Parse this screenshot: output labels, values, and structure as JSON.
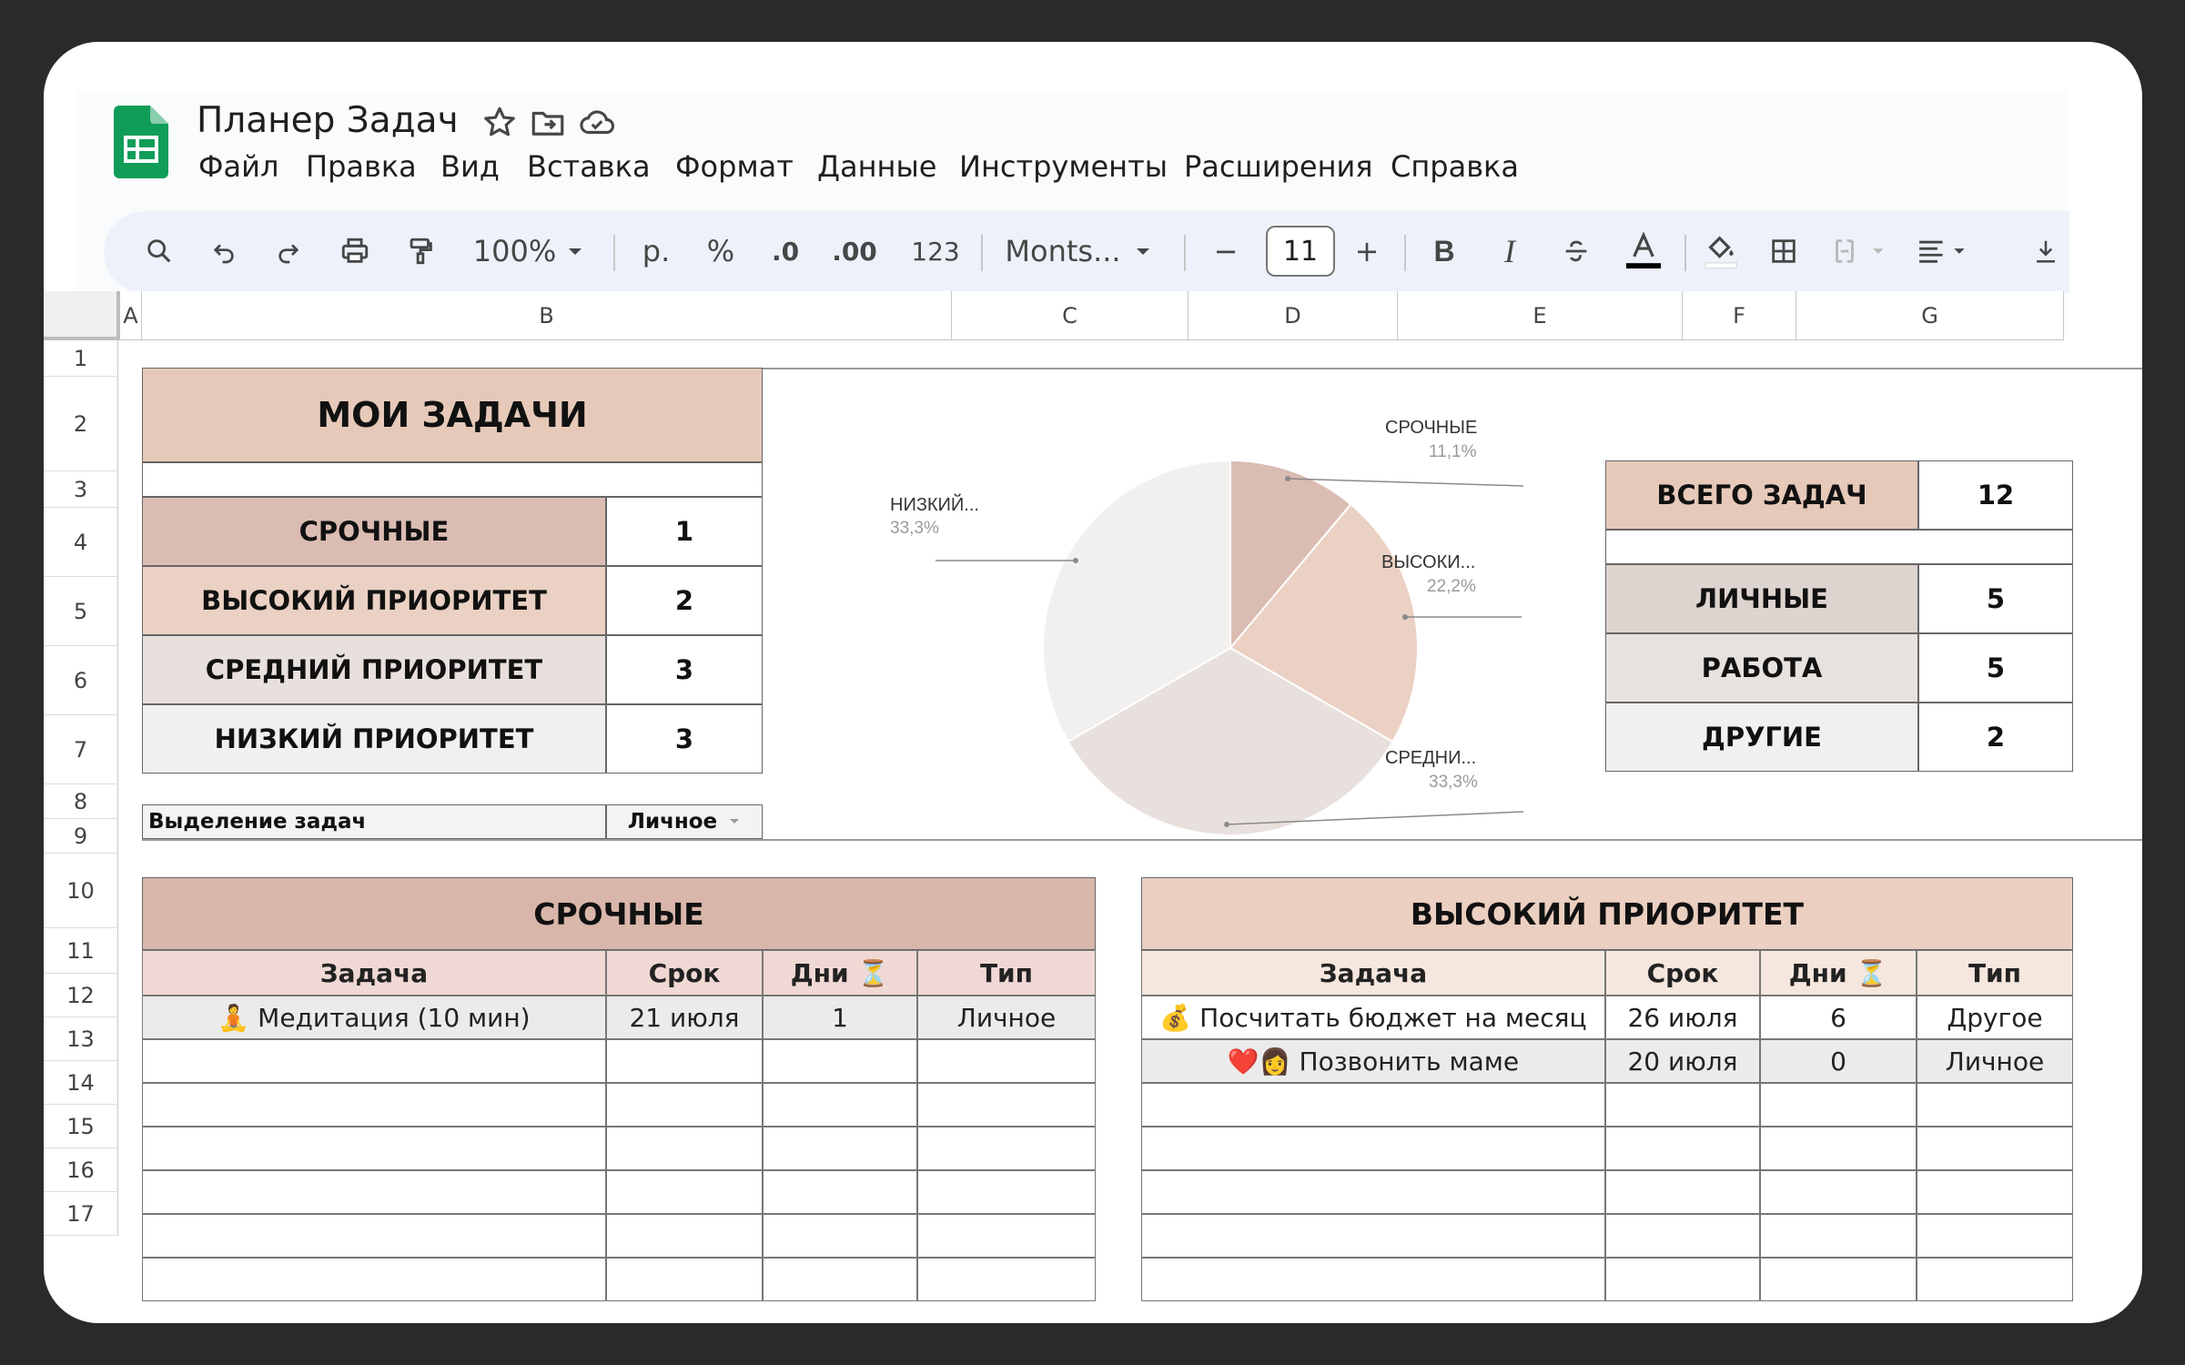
{
  "app": {
    "title": "Планер Задач",
    "menu": [
      "Файл",
      "Правка",
      "Вид",
      "Вставка",
      "Формат",
      "Данные",
      "Инструменты",
      "Расширения",
      "Справка"
    ]
  },
  "toolbar": {
    "zoom": "100%",
    "currency": "р.",
    "percent": "%",
    "dec_less": ".0",
    "dec_more": ".00",
    "number_format": "123",
    "font": "Monts...",
    "font_size": "11",
    "minus": "−",
    "plus": "+",
    "bold": "B",
    "italic": "I"
  },
  "columns": [
    "A",
    "B",
    "C",
    "D",
    "E",
    "F",
    "G"
  ],
  "rows": [
    "1",
    "2",
    "3",
    "4",
    "5",
    "6",
    "7",
    "8",
    "9",
    "10",
    "11",
    "12",
    "13",
    "14",
    "15",
    "16",
    "17"
  ],
  "summary": {
    "title": "МОИ ЗАДАЧИ",
    "items": [
      {
        "label": "СРОЧНЫЕ",
        "value": "1",
        "color": "#dbbcb2"
      },
      {
        "label": "ВЫСОКИЙ ПРИОРИТЕТ",
        "value": "2",
        "color": "#ebd1c3"
      },
      {
        "label": "СРЕДНИЙ ПРИОРИТЕТ",
        "value": "3",
        "color": "#e8e0dc"
      },
      {
        "label": "НИЗКИЙ ПРИОРИТЕТ",
        "value": "3",
        "color": "#f2f0ee"
      }
    ],
    "filter_label": "Выделение задач",
    "filter_value": "Личное"
  },
  "chart_data": {
    "type": "pie",
    "slices": [
      {
        "label": "СРОЧНЫЕ",
        "value": 11.1,
        "pct": "11,1%",
        "color": "#dbbcb2"
      },
      {
        "label": "ВЫСОКИ...",
        "value": 22.2,
        "pct": "22,2%",
        "color": "#ebd1c3"
      },
      {
        "label": "СРЕДНИ...",
        "value": 33.3,
        "pct": "33,3%",
        "color": "#e8e0dc"
      },
      {
        "label": "НИЗКИЙ...",
        "value": 33.3,
        "pct": "33,3%",
        "color": "#f2f0ee"
      }
    ]
  },
  "totals": {
    "total_label": "ВСЕГО ЗАДАЧ",
    "total_value": "12",
    "items": [
      {
        "label": "ЛИЧНЫЕ",
        "value": "5",
        "color": "#ddd3cf"
      },
      {
        "label": "РАБОТА",
        "value": "5",
        "color": "#e8e2df"
      },
      {
        "label": "ДРУГИЕ",
        "value": "2",
        "color": "#f2f0ee"
      }
    ]
  },
  "urgent": {
    "title": "СРОЧНЫЕ",
    "headers": [
      "Задача",
      "Срок",
      "Дни ⏳",
      "Тип"
    ],
    "rows": [
      [
        "🧘 Медитация (10 мин)",
        "21 июля",
        "1",
        "Личное"
      ]
    ]
  },
  "high": {
    "title": "ВЫСОКИЙ ПРИОРИТЕТ",
    "headers": [
      "Задача",
      "Срок",
      "Дни ⏳",
      "Тип"
    ],
    "rows": [
      [
        "💰 Посчитать бюджет на месяц",
        "26 июля",
        "6",
        "Другое"
      ],
      [
        "❤️👩 Позвонить маме",
        "20 июля",
        "0",
        "Личное"
      ]
    ]
  }
}
